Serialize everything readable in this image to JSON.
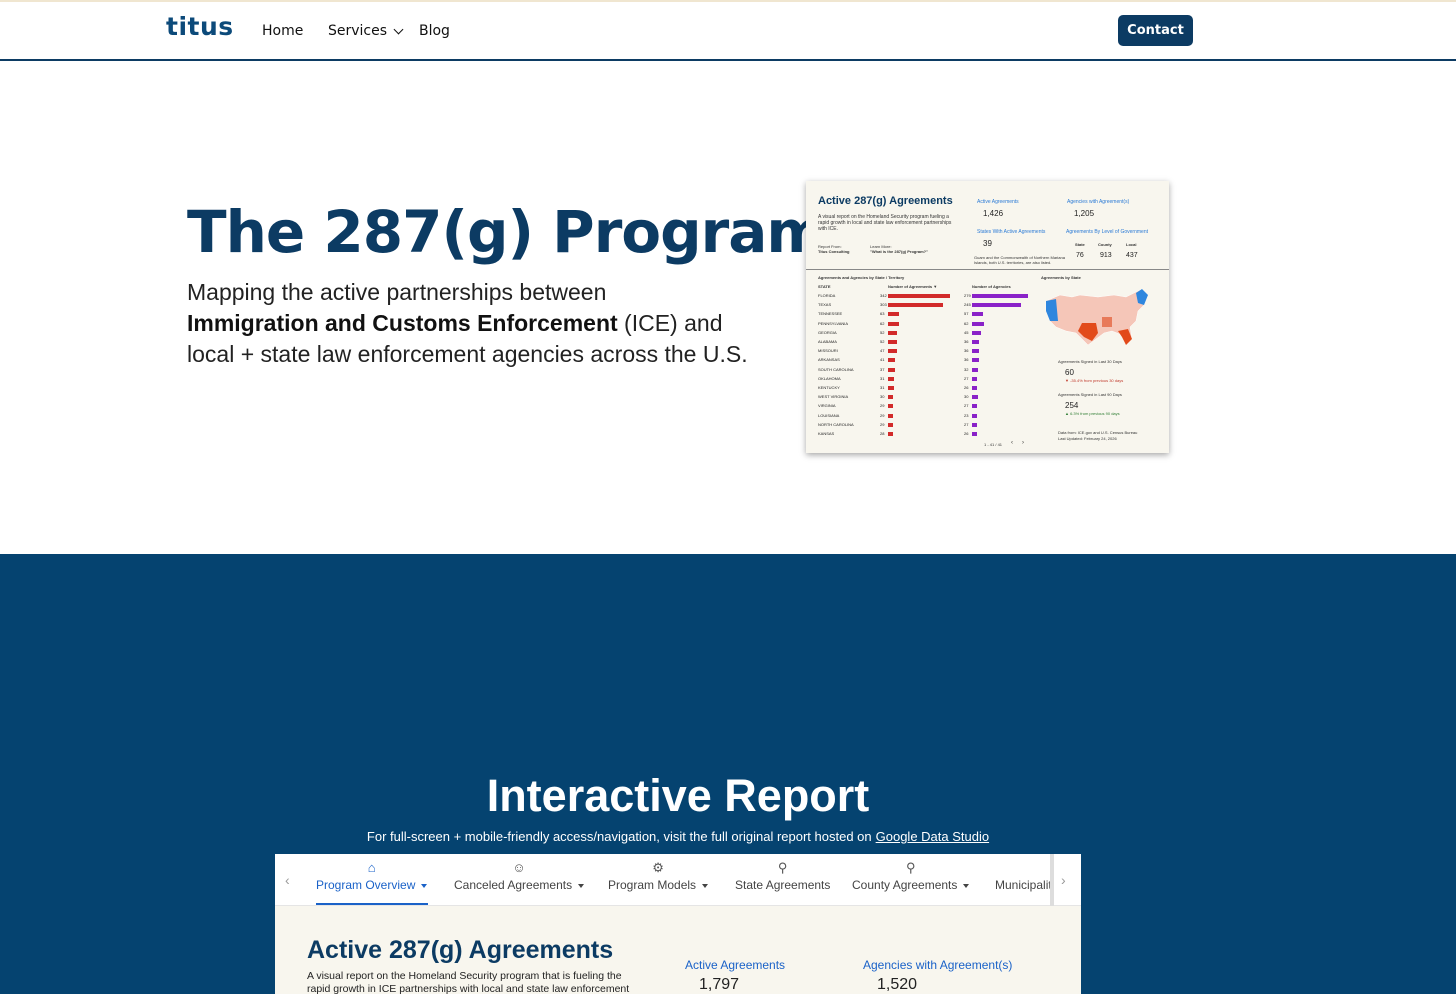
{
  "nav": {
    "logo": "titus",
    "home": "Home",
    "services": "Services",
    "blog": "Blog",
    "contact": "Contact"
  },
  "hero": {
    "title": "The 287(g) Program",
    "sub_1": "Mapping the active partnerships between",
    "sub_bold": "Immigration and Customs Enforcement",
    "sub_2": " (ICE) and local + state law enforcement agencies across the U.S."
  },
  "thumb": {
    "title": "Active 287(g) Agreements",
    "desc": "A visual report on the Homeland Security program fueling a rapid growth in local and state law enforcement partnerships with ICE.",
    "report_from": "Report From:",
    "report_org": "Titus Consulting",
    "learn_more": "Learn More:",
    "learn_title": "\"What is the 287(g) Program?\"",
    "active_label": "Active Agreements",
    "active_value": "1,426",
    "agencies_label": "Agencies with Agreement(s)",
    "agencies_value": "1,205",
    "states_label": "States With Active Agreements",
    "states_value": "39",
    "gov_label": "Agreements By Level of Government",
    "gov_state_label": "State",
    "gov_county_label": "County",
    "gov_local_label": "Local",
    "gov_state": "76",
    "gov_county": "913",
    "gov_local": "437",
    "note": "Guam and the Commonwealth of Northern Mariana Islands, both U.S. territories, are also listed.",
    "table_title": "Agreements and Agencies by State / Territory",
    "col_state": "STATE",
    "col_agreements": "Number of Agreements ▼",
    "col_agencies": "Number of Agencies",
    "map_title": "Agreements by State",
    "last30_label": "Agreements Signed in Last 30 Days",
    "last30_value": "60",
    "last30_change": "▼ -35.4% from previous 30 days",
    "last90_label": "Agreements Signed in Last 90 Days",
    "last90_value": "254",
    "last90_change": "▲ 6.3% from previous 90 days",
    "data_from": "Data from: ICE.gov and U.S. Census Bureau",
    "last_updated": "Last Updated: February 24, 2026",
    "pager": "1 - 41 / 41",
    "rows": [
      {
        "state": "FLORIDA",
        "agreements": 342,
        "agencies": 279
      },
      {
        "state": "TEXAS",
        "agreements": 303,
        "agencies": 245
      },
      {
        "state": "TENNESSEE",
        "agreements": 63,
        "agencies": 57
      },
      {
        "state": "PENNSYLVANIA",
        "agreements": 62,
        "agencies": 62
      },
      {
        "state": "GEORGIA",
        "agreements": 52,
        "agencies": 45
      },
      {
        "state": "ALABAMA",
        "agreements": 52,
        "agencies": 36
      },
      {
        "state": "MISSOURI",
        "agreements": 47,
        "agencies": 36
      },
      {
        "state": "ARKANSAS",
        "agreements": 41,
        "agencies": 36
      },
      {
        "state": "SOUTH CAROLINA",
        "agreements": 37,
        "agencies": 32
      },
      {
        "state": "OKLAHOMA",
        "agreements": 31,
        "agencies": 27
      },
      {
        "state": "KENTUCKY",
        "agreements": 31,
        "agencies": 26
      },
      {
        "state": "WEST VIRGINIA",
        "agreements": 30,
        "agencies": 30
      },
      {
        "state": "VIRGINIA",
        "agreements": 29,
        "agencies": 27
      },
      {
        "state": "LOUISIANA",
        "agreements": 29,
        "agencies": 23
      },
      {
        "state": "NORTH CAROLINA",
        "agreements": 29,
        "agencies": 27
      },
      {
        "state": "KANSAS",
        "agreements": 28,
        "agencies": 26
      }
    ]
  },
  "report": {
    "title": "Interactive Report",
    "sub": "For full-screen + mobile-friendly access/navigation, visit the full original report hosted on",
    "link": "Google Data Studio"
  },
  "embed": {
    "tabs": [
      {
        "label": "Program Overview",
        "icon": "home-icon",
        "glyph": "⌂",
        "caret": true,
        "active": true
      },
      {
        "label": "Canceled Agreements",
        "icon": "smiley-icon",
        "glyph": "☺",
        "caret": true,
        "active": false
      },
      {
        "label": "Program Models",
        "icon": "gears-icon",
        "glyph": "⚙",
        "caret": true,
        "active": false
      },
      {
        "label": "State Agreements",
        "icon": "search-icon",
        "glyph": "⚲",
        "caret": false,
        "active": false
      },
      {
        "label": "County Agreements",
        "icon": "pin-icon",
        "glyph": "⚲",
        "caret": true,
        "active": false
      },
      {
        "label": "Municipalit",
        "icon": "",
        "glyph": "",
        "caret": false,
        "active": false
      }
    ],
    "title": "Active 287(g) Agreements",
    "desc": "A visual report on the Homeland Security program that is fueling the rapid growth in ICE partnerships with local and state law enforcement",
    "active_label": "Active Agreements",
    "active_value": "1,797",
    "agencies_label": "Agencies with Agreement(s)",
    "agencies_value": "1,520"
  },
  "colors": {
    "navy": "#0c3b63",
    "blue_section": "#054370",
    "accent_blue": "#1a62c8",
    "bar_red": "#d22a2a",
    "bar_purple": "#8a22c8"
  }
}
